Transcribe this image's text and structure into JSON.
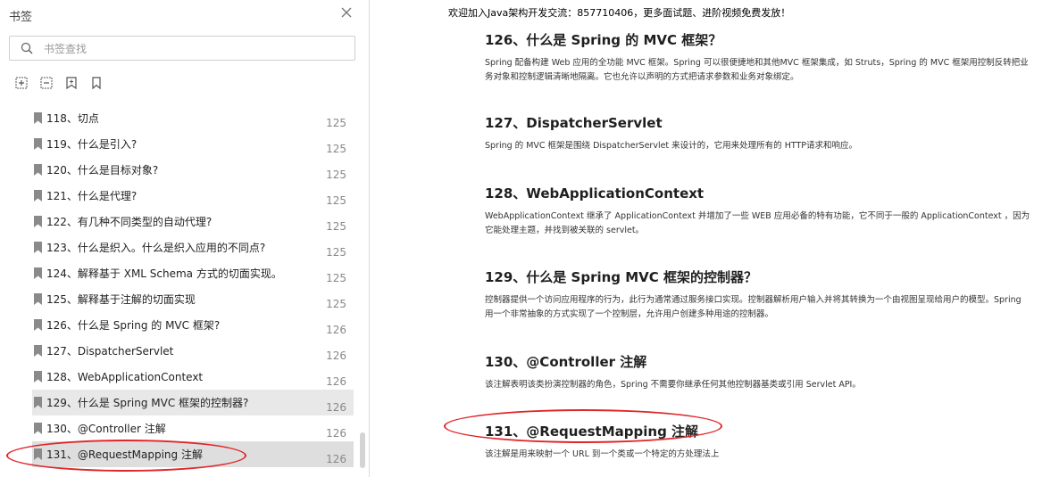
{
  "sidebar": {
    "title": "书签",
    "search_placeholder": "书签查找",
    "items": [
      {
        "label": "118、切点",
        "page": "125"
      },
      {
        "label": "119、什么是引入?",
        "page": "125"
      },
      {
        "label": "120、什么是目标对象?",
        "page": "125"
      },
      {
        "label": "121、什么是代理?",
        "page": "125"
      },
      {
        "label": "122、有几种不同类型的自动代理?",
        "page": "125"
      },
      {
        "label": "123、什么是织入。什么是织入应用的不同点?",
        "page": "125"
      },
      {
        "label": "124、解释基于 XML Schema 方式的切面实现。",
        "page": "125"
      },
      {
        "label": "125、解释基于注解的切面实现",
        "page": "125"
      },
      {
        "label": "126、什么是 Spring 的 MVC 框架?",
        "page": "126"
      },
      {
        "label": "127、DispatcherServlet",
        "page": "126"
      },
      {
        "label": "128、WebApplicationContext",
        "page": "126"
      },
      {
        "label": "129、什么是 Spring MVC 框架的控制器?",
        "page": "126"
      },
      {
        "label": "130、@Controller 注解",
        "page": "126"
      },
      {
        "label": "131、@RequestMapping 注解",
        "page": "126"
      }
    ]
  },
  "document": {
    "banner": "欢迎加入Java架构开发交流：857710406，更多面试题、进阶视频免费发放！",
    "sections": [
      {
        "heading": "126、什么是 Spring 的 MVC 框架？",
        "body": "Spring 配备构建 Web 应用的全功能 MVC 框架。Spring 可以很便捷地和其他MVC 框架集成，如 Struts，Spring 的 MVC 框架用控制反转把业务对象和控制逻辑清晰地隔离。它也允许以声明的方式把请求参数和业务对象绑定。"
      },
      {
        "heading": "127、DispatcherServlet",
        "body": "Spring 的 MVC 框架是围绕 DispatcherServlet 来设计的，它用来处理所有的 HTTP请求和响应。"
      },
      {
        "heading": "128、WebApplicationContext",
        "body": "WebApplicationContext 继承了 ApplicationContext 并增加了一些 WEB 应用必备的特有功能，它不同于一般的 ApplicationContext ，因为它能处理主题，并找到被关联的 servlet。"
      },
      {
        "heading": "129、什么是 Spring MVC 框架的控制器？",
        "body": "控制器提供一个访问应用程序的行为，此行为通常通过服务接口实现。控制器解析用户输入并将其转换为一个由视图呈现给用户的模型。Spring 用一个非常抽象的方式实现了一个控制层，允许用户创建多种用途的控制器。"
      },
      {
        "heading": "130、@Controller 注解",
        "body": "该注解表明该类扮演控制器的角色，Spring 不需要你继承任何其他控制器基类或引用 Servlet API。"
      },
      {
        "heading": "131、@RequestMapping 注解",
        "body": "该注解是用来映射一个 URL 到一个类或一个特定的方处理法上"
      }
    ]
  },
  "colors": {
    "annotation": "#e0262a",
    "selected_row": "#e8e8e8"
  }
}
